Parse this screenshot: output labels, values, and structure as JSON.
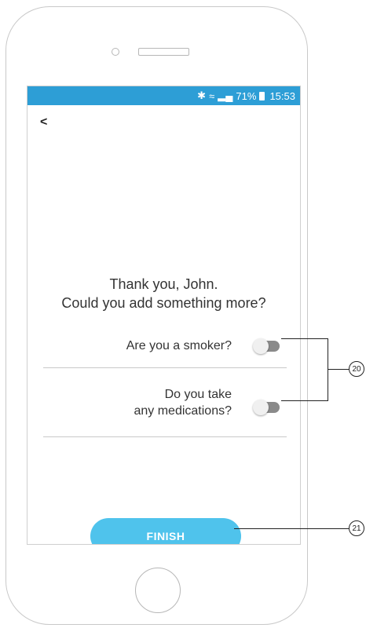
{
  "status_bar": {
    "bluetooth_icon": "bluetooth-icon",
    "wifi_icon": "wifi-icon",
    "signal_icon": "signal-icon",
    "battery": "71%",
    "time": "15:53"
  },
  "nav": {
    "back_label": "<"
  },
  "headline": {
    "line1": "Thank you, John.",
    "line2": "Could you add something more?"
  },
  "questions": [
    {
      "line1": "Are you a smoker?",
      "line2": ""
    },
    {
      "line1": "Do you take",
      "line2": "any medications?"
    }
  ],
  "finish_label": "FINISH",
  "annotations": {
    "toggles": "20",
    "finish": "21"
  },
  "colors": {
    "status_bar": "#2d9ed6",
    "finish_button": "#4fc3ec",
    "toggle_track": "#8a8a8a",
    "toggle_knob": "#f0f0f0"
  }
}
